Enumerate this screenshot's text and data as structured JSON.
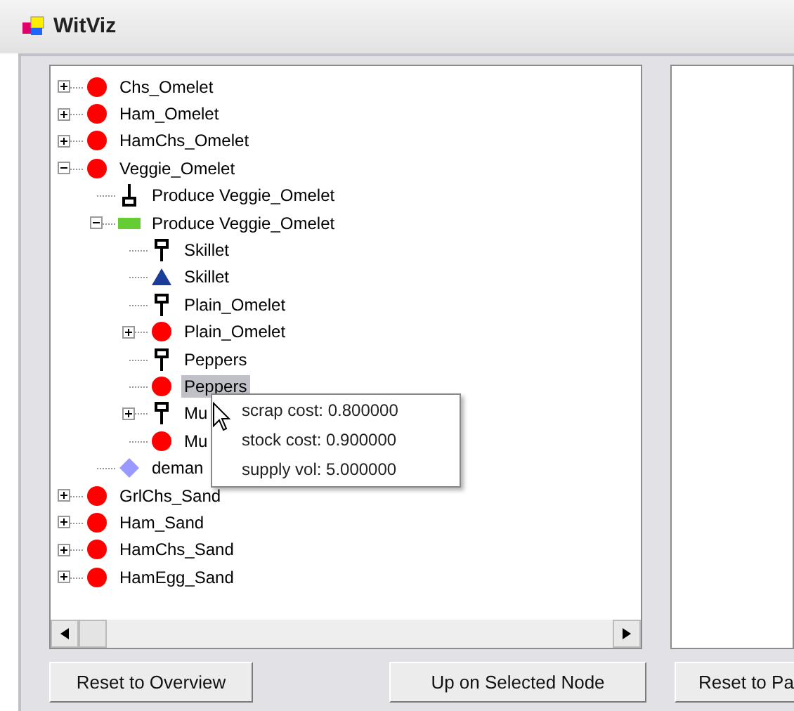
{
  "window": {
    "title": "WitViz"
  },
  "tree": [
    {
      "label": "Chs_Omelet",
      "kind": "circle",
      "expanded": false,
      "selected": false
    },
    {
      "label": "Ham_Omelet",
      "kind": "circle",
      "expanded": false,
      "selected": false
    },
    {
      "label": "HamChs_Omelet",
      "kind": "circle",
      "expanded": false,
      "selected": false
    },
    {
      "label": "Veggie_Omelet",
      "kind": "circle",
      "expanded": true,
      "selected": false,
      "children": [
        {
          "label": "Produce Veggie_Omelet",
          "kind": "anchor",
          "selected": false
        },
        {
          "label": "Produce Veggie_Omelet",
          "kind": "bar",
          "expanded": true,
          "selected": false,
          "children": [
            {
              "label": "Skillet",
              "kind": "pin",
              "selected": false
            },
            {
              "label": "Skillet",
              "kind": "triangle",
              "selected": false
            },
            {
              "label": "Plain_Omelet",
              "kind": "pin",
              "selected": false
            },
            {
              "label": "Plain_Omelet",
              "kind": "circle",
              "expanded": false,
              "selected": false
            },
            {
              "label": "Peppers",
              "kind": "pin",
              "selected": false
            },
            {
              "label": "Peppers",
              "kind": "circle",
              "selected": true
            },
            {
              "label": "Mu",
              "kind": "pin",
              "expanded": false,
              "selected": false
            },
            {
              "label": "Mu",
              "kind": "circle",
              "selected": false
            }
          ]
        },
        {
          "label": "deman",
          "kind": "diamond",
          "selected": false
        }
      ]
    },
    {
      "label": "GrlChs_Sand",
      "kind": "circle",
      "expanded": false,
      "selected": false
    },
    {
      "label": "Ham_Sand",
      "kind": "circle",
      "expanded": false,
      "selected": false
    },
    {
      "label": "HamChs_Sand",
      "kind": "circle",
      "expanded": false,
      "selected": false
    },
    {
      "label": "HamEgg_Sand",
      "kind": "circle",
      "expanded": false,
      "selected": false
    }
  ],
  "tooltip": [
    "scrap cost: 0.800000",
    "stock cost: 0.900000",
    "supply vol: 5.000000"
  ],
  "buttons": [
    "Reset to Overview",
    "Up on Selected Node",
    "Reset to Pa"
  ]
}
